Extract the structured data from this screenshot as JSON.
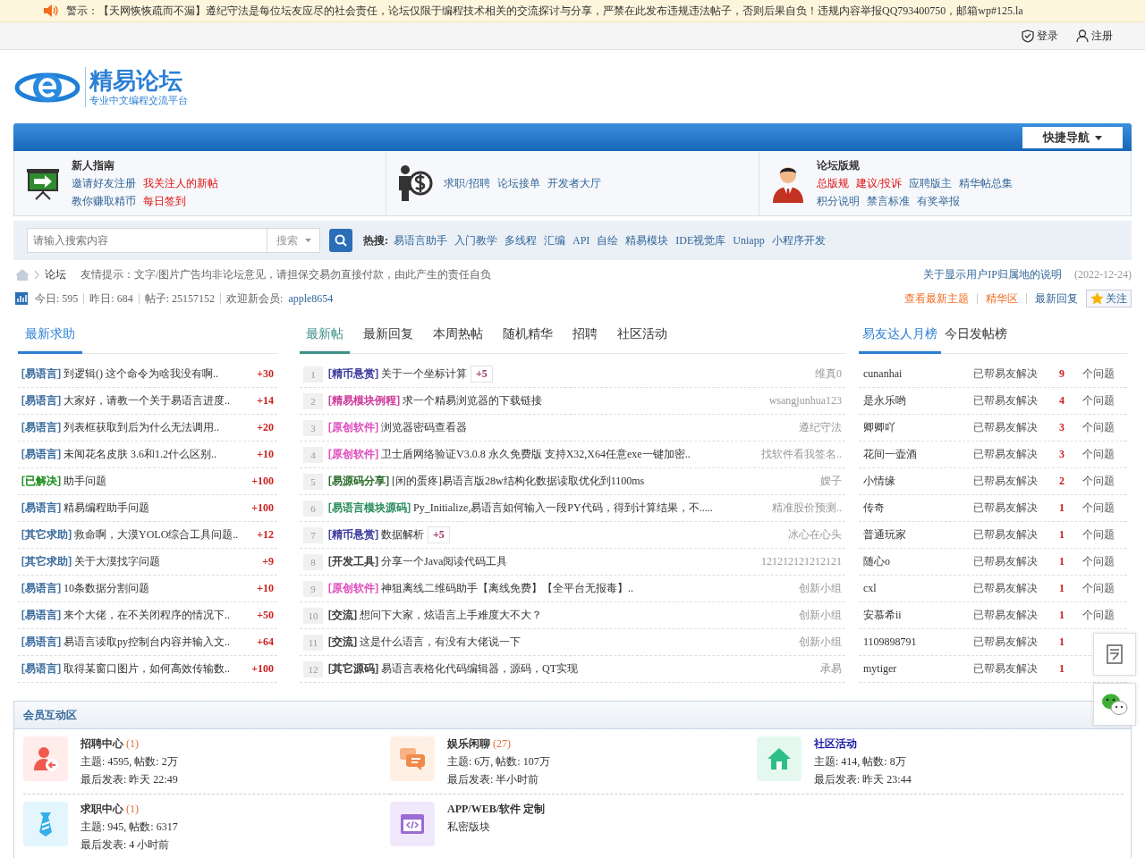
{
  "notice": "警示：【天网恢恢疏而不漏】遵纪守法是每位坛友应尽的社会责任，论坛仅限于编程技术相关的交流探讨与分享，严禁在此发布违规违法帖子，否则后果自负！违规内容举报QQ793400750，邮箱wp#125.la",
  "user_links": [
    {
      "label": "登录",
      "kind": "login"
    },
    {
      "label": "注册",
      "kind": "register"
    }
  ],
  "logo": {
    "name": "精易论坛",
    "tagline": "专业中文编程交流平台"
  },
  "quick_nav": "快捷导航",
  "guide": [
    {
      "kind": "projector",
      "title": "新人指南",
      "rows": [
        [
          {
            "label": "邀请好友注册",
            "highlight": false
          },
          {
            "label": "我关注人的新帖",
            "highlight": true
          }
        ],
        [
          {
            "label": "教你赚取精币",
            "highlight": false
          },
          {
            "label": "每日签到",
            "highlight": true
          }
        ]
      ]
    },
    {
      "kind": "money",
      "rows": [
        [
          {
            "label": "求职/招聘",
            "highlight": false
          },
          {
            "label": "论坛接单",
            "highlight": false
          },
          {
            "label": "开发者大厅",
            "highlight": false
          }
        ]
      ]
    },
    {
      "kind": "person",
      "title": "论坛版规",
      "rows": [
        [
          {
            "label": "总版规",
            "highlight": true
          },
          {
            "label": "建议/投诉",
            "highlight": true
          },
          {
            "label": "应聘版主",
            "highlight": false
          },
          {
            "label": "精华帖总集",
            "highlight": false
          }
        ],
        [
          {
            "label": "积分说明",
            "highlight": false
          },
          {
            "label": "禁言标准",
            "highlight": false
          },
          {
            "label": "有奖举报",
            "highlight": false
          }
        ]
      ]
    }
  ],
  "search": {
    "placeholder": "请输入搜索内容",
    "scope": "搜索",
    "hot_label": "热搜:",
    "hot": [
      "易语言助手",
      "入门教学",
      "多线程",
      "汇编",
      "API",
      "自绘",
      "精易模块",
      "IDE视觉库",
      "Uniapp",
      "小程序开发"
    ]
  },
  "breadcrumb": {
    "current": "论坛",
    "tip": "友情提示：文字/图片广告均非论坛意见，请担保交易勿直接付款，由此产生的责任自负",
    "notice_link": "关于显示用户IP归属地的说明",
    "notice_date": "(2022-12-24)"
  },
  "stats": [
    "今日: 595",
    "昨日: 684",
    "帖子: 25157152"
  ],
  "new_member": {
    "label": "欢迎新会员:",
    "name": "apple8654"
  },
  "quick_links": [
    {
      "label": "查看最新主题",
      "highlight": true
    },
    {
      "label": "精华区",
      "highlight": true
    },
    {
      "label": "最新回复",
      "highlight": false
    }
  ],
  "follow": "关注",
  "help": {
    "tabs": [
      {
        "label": "最新求助",
        "selected": true
      }
    ],
    "items": [
      {
        "tag": "[易语言]",
        "color": "#336699",
        "title": "到逻辑() 这个命令为啥我没有啊..",
        "reward": "+30"
      },
      {
        "tag": "[易语言]",
        "color": "#336699",
        "title": "大家好，请教一个关于易语言进度..",
        "reward": "+14"
      },
      {
        "tag": "[易语言]",
        "color": "#336699",
        "title": "列表框获取到后为什么无法调用..",
        "reward": "+20"
      },
      {
        "tag": "[易语言]",
        "color": "#336699",
        "title": "未闻花名皮肤 3.6和1.2什么区别..",
        "reward": "+10"
      },
      {
        "tag": "[已解决]",
        "color": "#118811",
        "title": "助手问题",
        "reward": "+100"
      },
      {
        "tag": "[易语言]",
        "color": "#336699",
        "title": "精易编程助手问题",
        "reward": "+100"
      },
      {
        "tag": "[其它求助]",
        "color": "#336699",
        "title": "救命啊，大漠YOLO综合工具问题..",
        "reward": "+12"
      },
      {
        "tag": "[其它求助]",
        "color": "#336699",
        "title": "关于大漠找字问题",
        "reward": "+9"
      },
      {
        "tag": "[易语言]",
        "color": "#336699",
        "title": "10条数据分割问题",
        "reward": "+10"
      },
      {
        "tag": "[易语言]",
        "color": "#336699",
        "title": "来个大佬，在不关闭程序的情况下..",
        "reward": "+50"
      },
      {
        "tag": "[易语言]",
        "color": "#336699",
        "title": "易语言读取py控制台内容并输入文..",
        "reward": "+64"
      },
      {
        "tag": "[易语言]",
        "color": "#336699",
        "title": "取得某窗口图片，如何高效传输数..",
        "reward": "+100"
      }
    ]
  },
  "latest": {
    "tabs": [
      {
        "label": "最新帖",
        "selected": true
      },
      {
        "label": "最新回复",
        "selected": false
      },
      {
        "label": "本周热帖",
        "selected": false
      },
      {
        "label": "随机精华",
        "selected": false
      },
      {
        "label": "招聘",
        "selected": false
      },
      {
        "label": "社区活动",
        "selected": false
      }
    ],
    "items": [
      {
        "num": "1",
        "tag": "[精币悬赏]",
        "color": "#333399",
        "title": "关于一个坐标计算",
        "bounty": "+5",
        "author": "维真0"
      },
      {
        "num": "2",
        "tag": "[精易模块例程]",
        "color": "#cc3399",
        "title": "求一个精易浏览器的下载链接",
        "author": "wsangjunhua123"
      },
      {
        "num": "3",
        "tag": "[原创软件]",
        "color": "#dd44bb",
        "title": "浏览器密码查看器",
        "author": "遵纪守法"
      },
      {
        "num": "4",
        "tag": "[原创软件]",
        "color": "#dd44bb",
        "title": "卫士盾网络验证V3.0.8 永久免费版 支持X32,X64任意exe一键加密..",
        "author": "找软件看我签名.."
      },
      {
        "num": "5",
        "tag": "[易源码分享]",
        "color": "#226622",
        "title": "[闲的蛋疼]易语言版28w结构化数据读取优化到1100ms",
        "author": "嫂子"
      },
      {
        "num": "6",
        "tag": "[易语言模块源码]",
        "color": "#228855",
        "title": "Py_Initialize,易语言如何输入一段PY代码，得到计算结果，不.....",
        "author": "精准股价预测.."
      },
      {
        "num": "7",
        "tag": "[精币悬赏]",
        "color": "#333399",
        "title": "数据解析",
        "bounty": "+5",
        "author": "冰心在心头"
      },
      {
        "num": "8",
        "tag": "[开发工具]",
        "color": "#333333",
        "title": "分享一个Java阅读代码工具",
        "author": "121212121212121"
      },
      {
        "num": "9",
        "tag": "[原创软件]",
        "color": "#dd44bb",
        "title": "神狙离线二维码助手【离线免费】【全平台无报毒】..",
        "author": "创新小组"
      },
      {
        "num": "10",
        "tag": "[交流]",
        "color": "#333333",
        "title": "想问下大家，炫语言上手难度大不大？",
        "author": "创新小组"
      },
      {
        "num": "11",
        "tag": "[交流]",
        "color": "#333333",
        "title": "这是什么语言，有没有大佬说一下",
        "author": "创新小组"
      },
      {
        "num": "12",
        "tag": "[其它源码]",
        "color": "#333333",
        "title": "易语言表格化代码编辑器，源码，QT实现",
        "author": "承易"
      }
    ]
  },
  "ranking": {
    "tabs": [
      {
        "label": "易友达人月榜",
        "selected": true
      },
      {
        "label": "今日发帖榜",
        "selected": false
      }
    ],
    "items": [
      {
        "name": "cunanhai",
        "label": "已帮易友解决",
        "count": "9",
        "unit": "个问题"
      },
      {
        "name": "是永乐哟",
        "label": "已帮易友解决",
        "count": "4",
        "unit": "个问题"
      },
      {
        "name": "卿卿吖",
        "label": "已帮易友解决",
        "count": "3",
        "unit": "个问题"
      },
      {
        "name": "花间一壶酒",
        "label": "已帮易友解决",
        "count": "3",
        "unit": "个问题"
      },
      {
        "name": "小情缘",
        "label": "已帮易友解决",
        "count": "2",
        "unit": "个问题"
      },
      {
        "name": "传奇",
        "label": "已帮易友解决",
        "count": "1",
        "unit": "个问题"
      },
      {
        "name": "普通玩家",
        "label": "已帮易友解决",
        "count": "1",
        "unit": "个问题"
      },
      {
        "name": "随心o",
        "label": "已帮易友解决",
        "count": "1",
        "unit": "个问题"
      },
      {
        "name": "cxl",
        "label": "已帮易友解决",
        "count": "1",
        "unit": "个问题"
      },
      {
        "name": "安慕希ii",
        "label": "已帮易友解决",
        "count": "1",
        "unit": "个问题"
      },
      {
        "name": "1109898791",
        "label": "已帮易友解决",
        "count": "1"
      },
      {
        "name": "mytiger",
        "label": "已帮易友解决",
        "count": "1"
      }
    ]
  },
  "member_zone": {
    "title": "会员互动区",
    "forums": [
      {
        "kind": "recruit",
        "name": "招聘中心",
        "count": "(1)",
        "highlight": false,
        "lines": [
          "主题: 4595, 帖数: 2万",
          "最后发表: 昨天 22:49"
        ]
      },
      {
        "kind": "chat",
        "name": "娱乐闲聊",
        "count": "(27)",
        "highlight": false,
        "lines": [
          "主题: 6万, 帖数: 107万",
          "最后发表: 半小时前"
        ]
      },
      {
        "kind": "home",
        "name": "社区活动",
        "highlight": true,
        "lines": [
          "主题: 414, 帖数: 8万",
          "最后发表: 昨天 23:44"
        ]
      },
      {
        "kind": "job",
        "name": "求职中心",
        "count": "(1)",
        "highlight": false,
        "lines": [
          "主题: 945, 帖数: 6317",
          "最后发表: 4 小时前"
        ]
      },
      {
        "kind": "code",
        "name": "APP/WEB/软件 定制",
        "highlight": false,
        "lines": [
          "私密版块"
        ]
      }
    ]
  }
}
